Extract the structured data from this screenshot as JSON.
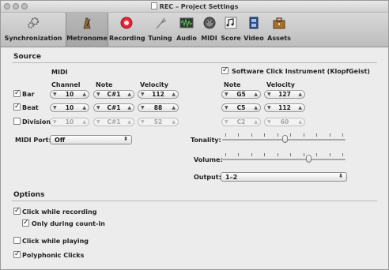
{
  "window": {
    "title": "REC – Project Settings"
  },
  "toolbar": {
    "tabs": [
      {
        "label": "Synchronization",
        "icon": "gears-icon"
      },
      {
        "label": "Metronome",
        "icon": "metronome-icon",
        "selected": true
      },
      {
        "label": "Recording",
        "icon": "record-icon"
      },
      {
        "label": "Tuning",
        "icon": "tuning-fork-icon"
      },
      {
        "label": "Audio",
        "icon": "audio-waveform-icon"
      },
      {
        "label": "MIDI",
        "icon": "midi-plug-icon"
      },
      {
        "label": "Score",
        "icon": "score-notes-icon"
      },
      {
        "label": "Video",
        "icon": "video-film-icon"
      },
      {
        "label": "Assets",
        "icon": "assets-case-icon"
      }
    ]
  },
  "source": {
    "title": "Source",
    "midi_header": "MIDI",
    "columns": {
      "channel": "Channel",
      "note": "Note",
      "velocity": "Velocity"
    },
    "software_click": {
      "label": "Software Click Instrument (KlopfGeist)",
      "checked": true,
      "note_header": "Note",
      "velocity_header": "Velocity"
    },
    "rows": [
      {
        "label": "Bar",
        "checked": true,
        "channel": "10",
        "note": "C#1",
        "velocity": "112",
        "sw_note": "G5",
        "sw_velocity": "127",
        "enabled": true
      },
      {
        "label": "Beat",
        "checked": true,
        "channel": "10",
        "note": "C#1",
        "velocity": "88",
        "sw_note": "C5",
        "sw_velocity": "112",
        "enabled": true
      },
      {
        "label": "Division",
        "checked": false,
        "channel": "10",
        "note": "C#1",
        "velocity": "52",
        "sw_note": "C2",
        "sw_velocity": "60",
        "enabled": false
      }
    ],
    "midi_port": {
      "label": "MIDI Port:",
      "value": "Off"
    },
    "tonality": {
      "label": "Tonality:",
      "level": 0.51
    },
    "volume": {
      "label": "Volume:",
      "level": 0.71
    },
    "output": {
      "label": "Output:",
      "value": "1–2"
    }
  },
  "options": {
    "title": "Options",
    "items": [
      {
        "label": "Click while recording",
        "checked": true
      },
      {
        "label": "Only during count-in",
        "checked": true
      },
      {
        "label": "Click while playing",
        "checked": false
      },
      {
        "label": "Polyphonic Clicks",
        "checked": true
      }
    ]
  },
  "colors": {
    "record": "#e8243a",
    "accent": "#3b73c9"
  }
}
